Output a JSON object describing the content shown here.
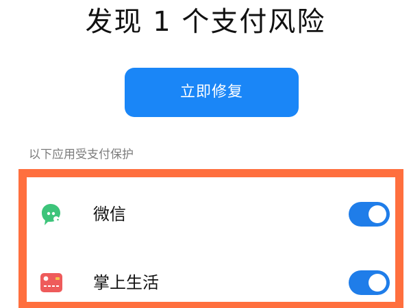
{
  "header": {
    "title": "发现 1 个支付风险"
  },
  "actions": {
    "fix_label": "立即修复"
  },
  "protection": {
    "section_label": "以下应用受支付保护",
    "apps": [
      {
        "name": "微信",
        "icon": "wechat-icon",
        "enabled": true
      },
      {
        "name": "掌上生活",
        "icon": "card-wallet-icon",
        "enabled": true
      }
    ]
  },
  "colors": {
    "accent": "#1a86f7",
    "toggle_on": "#1f7de9",
    "highlight": "#ff6f3e",
    "wechat_green": "#3dc47a",
    "card_red": "#ee5b5b"
  }
}
